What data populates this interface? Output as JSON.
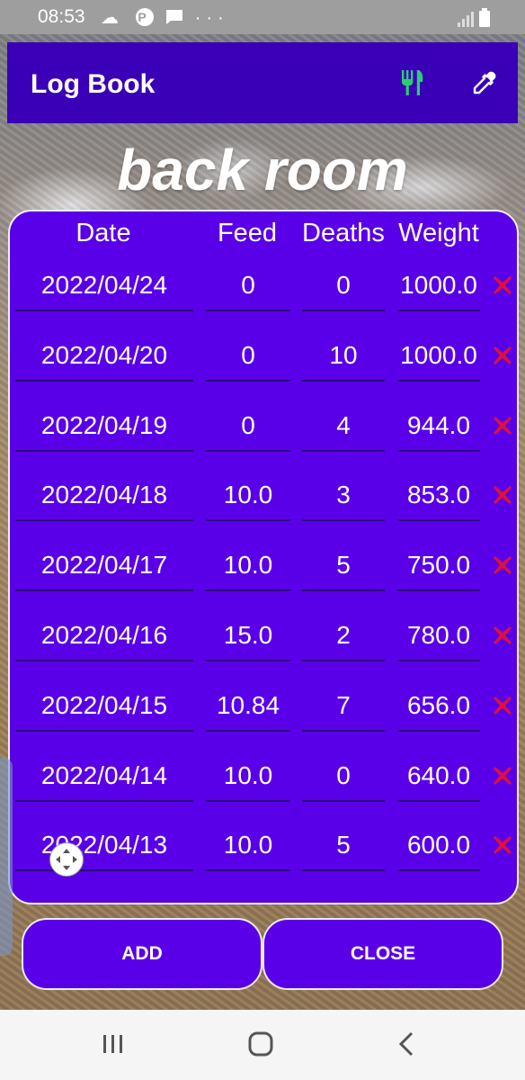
{
  "status_bar": {
    "time": "08:53",
    "icons": [
      "cloud-icon",
      "pinterest-icon",
      "message-icon",
      "more-icon"
    ]
  },
  "app_bar": {
    "title": "Log Book",
    "feed_icon": "fork-knife-icon",
    "feed_icon_color": "#2ecc71",
    "dropper_icon": "dropper-icon"
  },
  "heading": "back room",
  "table": {
    "headers": {
      "date": "Date",
      "feed": "Feed",
      "deaths": "Deaths",
      "weight": "Weight"
    },
    "rows": [
      {
        "date": "2022/04/24",
        "feed": "0",
        "deaths": "0",
        "weight": "1000.0"
      },
      {
        "date": "2022/04/20",
        "feed": "0",
        "deaths": "10",
        "weight": "1000.0"
      },
      {
        "date": "2022/04/19",
        "feed": "0",
        "deaths": "4",
        "weight": "944.0"
      },
      {
        "date": "2022/04/18",
        "feed": "10.0",
        "deaths": "3",
        "weight": "853.0"
      },
      {
        "date": "2022/04/17",
        "feed": "10.0",
        "deaths": "5",
        "weight": "750.0"
      },
      {
        "date": "2022/04/16",
        "feed": "15.0",
        "deaths": "2",
        "weight": "780.0"
      },
      {
        "date": "2022/04/15",
        "feed": "10.84",
        "deaths": "7",
        "weight": "656.0"
      },
      {
        "date": "2022/04/14",
        "feed": "10.0",
        "deaths": "0",
        "weight": "640.0"
      },
      {
        "date": "2022/04/13",
        "feed": "10.0",
        "deaths": "5",
        "weight": "600.0"
      }
    ]
  },
  "buttons": {
    "add": "ADD",
    "close": "CLOSE"
  },
  "colors": {
    "app_bar": "#3a00b8",
    "dialog": "#5a00e8",
    "delete": "#e0103a"
  }
}
